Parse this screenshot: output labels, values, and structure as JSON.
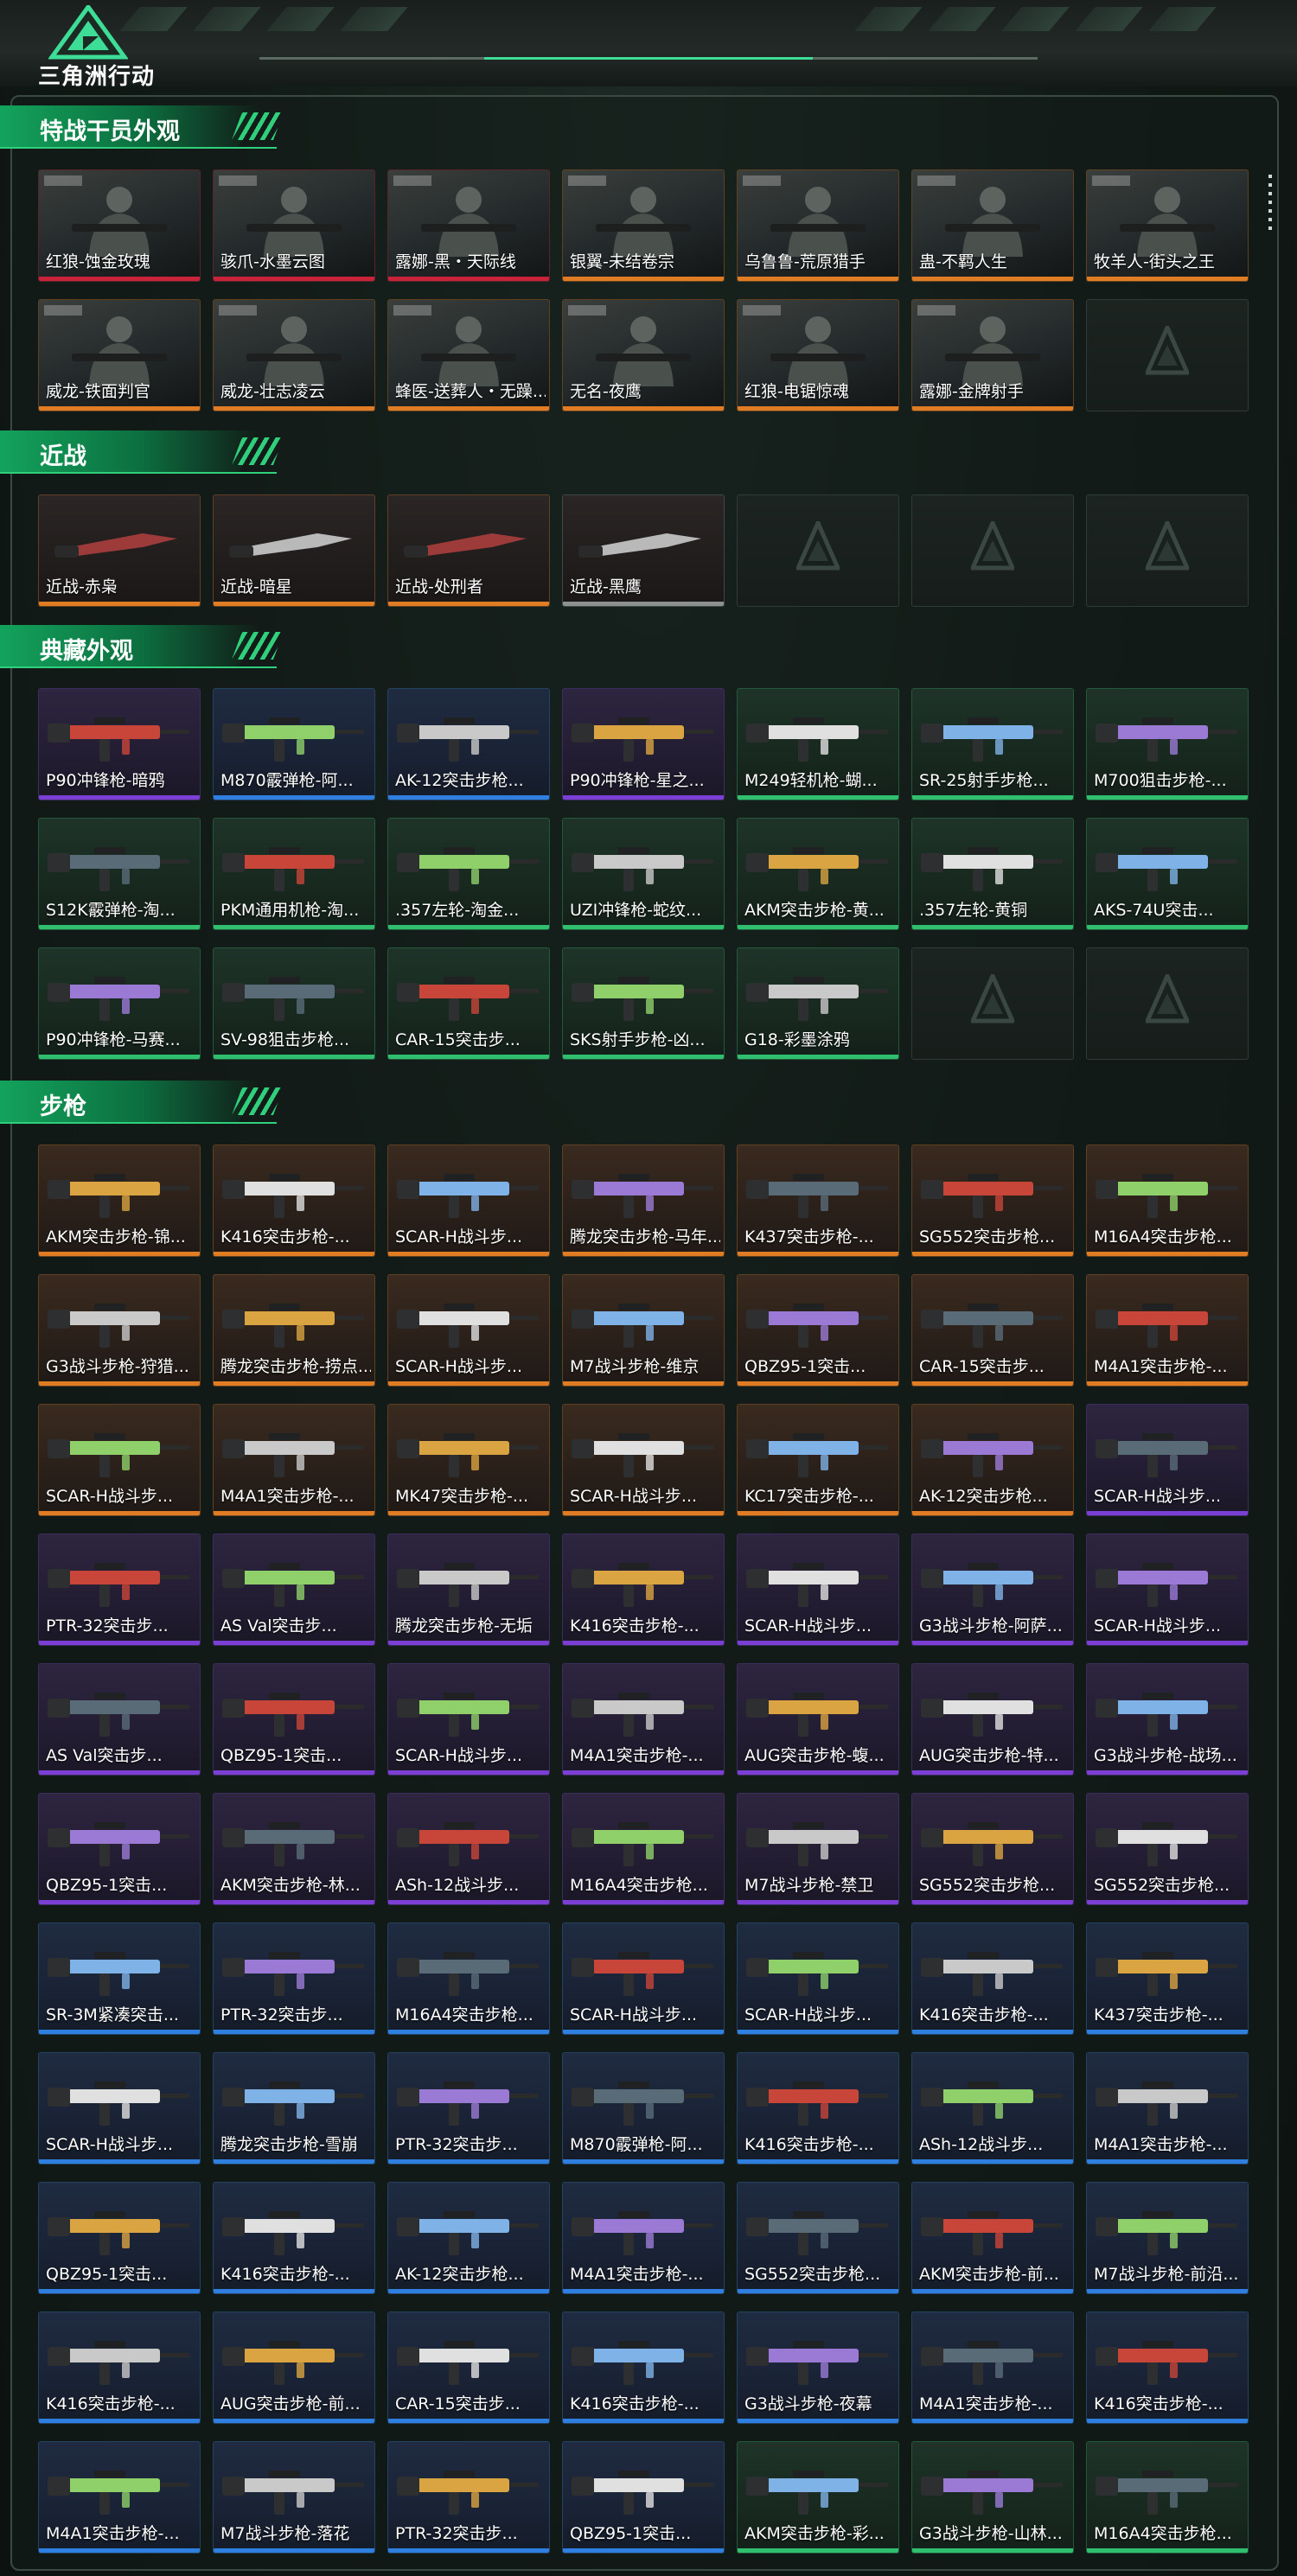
{
  "header": {
    "brand": "三角洲行动"
  },
  "colors": {
    "accent": "#2fcf7c",
    "rarity_orange": "#e07c24",
    "rarity_red": "#c8233a",
    "rarity_purple": "#7b3fd6",
    "rarity_blue": "#2f7fe0",
    "rarity_green": "#2fbf6f"
  },
  "sections": [
    {
      "title": "特战干员外观",
      "items": [
        {
          "label": "红狼-蚀金玫瑰",
          "rarity": "red",
          "tone": "operator"
        },
        {
          "label": "骇爪-水墨云图",
          "rarity": "red",
          "tone": "operator"
        },
        {
          "label": "露娜-黑・天际线",
          "rarity": "red",
          "tone": "operator"
        },
        {
          "label": "银翼-未结卷宗",
          "rarity": "orange",
          "tone": "operator"
        },
        {
          "label": "乌鲁鲁-荒原猎手",
          "rarity": "orange",
          "tone": "operator"
        },
        {
          "label": "蛊-不羁人生",
          "rarity": "orange",
          "tone": "operator"
        },
        {
          "label": "牧羊人-街头之王",
          "rarity": "orange",
          "tone": "operator"
        },
        {
          "label": "威龙-铁面判官",
          "rarity": "orange",
          "tone": "operator"
        },
        {
          "label": "威龙-壮志凌云",
          "rarity": "orange",
          "tone": "operator"
        },
        {
          "label": "蜂医-送葬人・无躁...",
          "rarity": "orange",
          "tone": "operator"
        },
        {
          "label": "无名-夜鹰",
          "rarity": "orange",
          "tone": "operator"
        },
        {
          "label": "红狼-电锯惊魂",
          "rarity": "orange",
          "tone": "operator"
        },
        {
          "label": "露娜-金牌射手",
          "rarity": "orange",
          "tone": "operator"
        }
      ]
    },
    {
      "title": "近战",
      "items": [
        {
          "label": "近战-赤枭",
          "rarity": "orange",
          "tone": "melee"
        },
        {
          "label": "近战-暗星",
          "rarity": "orange",
          "tone": "melee"
        },
        {
          "label": "近战-处刑者",
          "rarity": "orange",
          "tone": "melee"
        },
        {
          "label": "近战-黑鹰",
          "rarity": "grey",
          "tone": "melee"
        }
      ]
    },
    {
      "title": "典藏外观",
      "items": [
        {
          "label": "P90冲锋枪-暗鸦",
          "rarity": "purple",
          "tone": "purple"
        },
        {
          "label": "M870霰弹枪-阿...",
          "rarity": "blue",
          "tone": "blue"
        },
        {
          "label": "AK-12突击步枪...",
          "rarity": "blue",
          "tone": "blue"
        },
        {
          "label": "P90冲锋枪-星之...",
          "rarity": "purple",
          "tone": "purple"
        },
        {
          "label": "M249轻机枪-蝴...",
          "rarity": "green",
          "tone": "green"
        },
        {
          "label": "SR-25射手步枪...",
          "rarity": "green",
          "tone": "green"
        },
        {
          "label": "M700狙击步枪-...",
          "rarity": "green",
          "tone": "green"
        },
        {
          "label": "S12K霰弹枪-淘...",
          "rarity": "green",
          "tone": "green"
        },
        {
          "label": "PKM通用机枪-淘...",
          "rarity": "green",
          "tone": "green"
        },
        {
          "label": ".357左轮-淘金...",
          "rarity": "green",
          "tone": "green"
        },
        {
          "label": "UZI冲锋枪-蛇纹...",
          "rarity": "green",
          "tone": "green"
        },
        {
          "label": "AKM突击步枪-黄...",
          "rarity": "green",
          "tone": "green"
        },
        {
          "label": ".357左轮-黄铜",
          "rarity": "green",
          "tone": "green"
        },
        {
          "label": "AKS-74U突击...",
          "rarity": "green",
          "tone": "green"
        },
        {
          "label": "P90冲锋枪-马赛...",
          "rarity": "green",
          "tone": "green"
        },
        {
          "label": "SV-98狙击步枪...",
          "rarity": "green",
          "tone": "green"
        },
        {
          "label": "CAR-15突击步...",
          "rarity": "green",
          "tone": "green"
        },
        {
          "label": "SKS射手步枪-凶...",
          "rarity": "green",
          "tone": "green"
        },
        {
          "label": "G18-彩墨涂鸦",
          "rarity": "green",
          "tone": "green"
        }
      ]
    },
    {
      "title": "步枪",
      "items": [
        {
          "label": "AKM突击步枪-锦...",
          "rarity": "orange",
          "tone": "orange"
        },
        {
          "label": "K416突击步枪-...",
          "rarity": "orange",
          "tone": "orange"
        },
        {
          "label": "SCAR-H战斗步...",
          "rarity": "orange",
          "tone": "orange"
        },
        {
          "label": "腾龙突击步枪-马年...",
          "rarity": "orange",
          "tone": "orange"
        },
        {
          "label": "K437突击步枪-...",
          "rarity": "orange",
          "tone": "orange"
        },
        {
          "label": "SG552突击步枪...",
          "rarity": "orange",
          "tone": "orange"
        },
        {
          "label": "M16A4突击步枪...",
          "rarity": "orange",
          "tone": "orange"
        },
        {
          "label": "G3战斗步枪-狩猎...",
          "rarity": "orange",
          "tone": "orange"
        },
        {
          "label": "腾龙突击步枪-捞点...",
          "rarity": "orange",
          "tone": "orange"
        },
        {
          "label": "SCAR-H战斗步...",
          "rarity": "orange",
          "tone": "orange"
        },
        {
          "label": "M7战斗步枪-维京",
          "rarity": "orange",
          "tone": "orange"
        },
        {
          "label": "QBZ95-1突击...",
          "rarity": "orange",
          "tone": "orange"
        },
        {
          "label": "CAR-15突击步...",
          "rarity": "orange",
          "tone": "orange"
        },
        {
          "label": "M4A1突击步枪-...",
          "rarity": "orange",
          "tone": "orange"
        },
        {
          "label": "SCAR-H战斗步...",
          "rarity": "orange",
          "tone": "orange"
        },
        {
          "label": "M4A1突击步枪-...",
          "rarity": "orange",
          "tone": "orange"
        },
        {
          "label": "MK47突击步枪-...",
          "rarity": "orange",
          "tone": "orange"
        },
        {
          "label": "SCAR-H战斗步...",
          "rarity": "orange",
          "tone": "orange"
        },
        {
          "label": "KC17突击步枪-...",
          "rarity": "orange",
          "tone": "orange"
        },
        {
          "label": "AK-12突击步枪...",
          "rarity": "orange",
          "tone": "orange"
        },
        {
          "label": "SCAR-H战斗步...",
          "rarity": "purple",
          "tone": "purple"
        },
        {
          "label": "PTR-32突击步...",
          "rarity": "purple",
          "tone": "purple"
        },
        {
          "label": "AS Val突击步...",
          "rarity": "purple",
          "tone": "purple"
        },
        {
          "label": "腾龙突击步枪-无垢",
          "rarity": "purple",
          "tone": "purple"
        },
        {
          "label": "K416突击步枪-...",
          "rarity": "purple",
          "tone": "purple"
        },
        {
          "label": "SCAR-H战斗步...",
          "rarity": "purple",
          "tone": "purple"
        },
        {
          "label": "G3战斗步枪-阿萨...",
          "rarity": "purple",
          "tone": "purple"
        },
        {
          "label": "SCAR-H战斗步...",
          "rarity": "purple",
          "tone": "purple"
        },
        {
          "label": "AS Val突击步...",
          "rarity": "purple",
          "tone": "purple"
        },
        {
          "label": "QBZ95-1突击...",
          "rarity": "purple",
          "tone": "purple"
        },
        {
          "label": "SCAR-H战斗步...",
          "rarity": "purple",
          "tone": "purple"
        },
        {
          "label": "M4A1突击步枪-...",
          "rarity": "purple",
          "tone": "purple"
        },
        {
          "label": "AUG突击步枪-蝮...",
          "rarity": "purple",
          "tone": "purple"
        },
        {
          "label": "AUG突击步枪-特...",
          "rarity": "purple",
          "tone": "purple"
        },
        {
          "label": "G3战斗步枪-战场...",
          "rarity": "purple",
          "tone": "purple"
        },
        {
          "label": "QBZ95-1突击...",
          "rarity": "purple",
          "tone": "purple"
        },
        {
          "label": "AKM突击步枪-林...",
          "rarity": "purple",
          "tone": "purple"
        },
        {
          "label": "ASh-12战斗步...",
          "rarity": "purple",
          "tone": "purple"
        },
        {
          "label": "M16A4突击步枪...",
          "rarity": "purple",
          "tone": "purple"
        },
        {
          "label": "M7战斗步枪-禁卫",
          "rarity": "purple",
          "tone": "purple"
        },
        {
          "label": "SG552突击步枪...",
          "rarity": "purple",
          "tone": "purple"
        },
        {
          "label": "SG552突击步枪...",
          "rarity": "purple",
          "tone": "purple"
        },
        {
          "label": "SR-3M紧凑突击...",
          "rarity": "blue",
          "tone": "blue"
        },
        {
          "label": "PTR-32突击步...",
          "rarity": "blue",
          "tone": "blue"
        },
        {
          "label": "M16A4突击步枪...",
          "rarity": "blue",
          "tone": "blue"
        },
        {
          "label": "SCAR-H战斗步...",
          "rarity": "blue",
          "tone": "blue"
        },
        {
          "label": "SCAR-H战斗步...",
          "rarity": "blue",
          "tone": "blue"
        },
        {
          "label": "K416突击步枪-...",
          "rarity": "blue",
          "tone": "blue"
        },
        {
          "label": "K437突击步枪-...",
          "rarity": "blue",
          "tone": "blue"
        },
        {
          "label": "SCAR-H战斗步...",
          "rarity": "blue",
          "tone": "blue"
        },
        {
          "label": "腾龙突击步枪-雪崩",
          "rarity": "blue",
          "tone": "blue"
        },
        {
          "label": "PTR-32突击步...",
          "rarity": "blue",
          "tone": "blue"
        },
        {
          "label": "M870霰弹枪-阿...",
          "rarity": "blue",
          "tone": "blue"
        },
        {
          "label": "K416突击步枪-...",
          "rarity": "blue",
          "tone": "blue"
        },
        {
          "label": "ASh-12战斗步...",
          "rarity": "blue",
          "tone": "blue"
        },
        {
          "label": "M4A1突击步枪-...",
          "rarity": "blue",
          "tone": "blue"
        },
        {
          "label": "QBZ95-1突击...",
          "rarity": "blue",
          "tone": "blue"
        },
        {
          "label": "K416突击步枪-...",
          "rarity": "blue",
          "tone": "blue"
        },
        {
          "label": "AK-12突击步枪...",
          "rarity": "blue",
          "tone": "blue"
        },
        {
          "label": "M4A1突击步枪-...",
          "rarity": "blue",
          "tone": "blue"
        },
        {
          "label": "SG552突击步枪...",
          "rarity": "blue",
          "tone": "blue"
        },
        {
          "label": "AKM突击步枪-前...",
          "rarity": "blue",
          "tone": "blue"
        },
        {
          "label": "M7战斗步枪-前沿...",
          "rarity": "blue",
          "tone": "blue"
        },
        {
          "label": "K416突击步枪-...",
          "rarity": "blue",
          "tone": "blue"
        },
        {
          "label": "AUG突击步枪-前...",
          "rarity": "blue",
          "tone": "blue"
        },
        {
          "label": "CAR-15突击步...",
          "rarity": "blue",
          "tone": "blue"
        },
        {
          "label": "K416突击步枪-...",
          "rarity": "blue",
          "tone": "blue"
        },
        {
          "label": "G3战斗步枪-夜幕",
          "rarity": "blue",
          "tone": "blue"
        },
        {
          "label": "M4A1突击步枪-...",
          "rarity": "blue",
          "tone": "blue"
        },
        {
          "label": "K416突击步枪-...",
          "rarity": "blue",
          "tone": "blue"
        },
        {
          "label": "M4A1突击步枪-...",
          "rarity": "blue",
          "tone": "blue"
        },
        {
          "label": "M7战斗步枪-落花",
          "rarity": "blue",
          "tone": "blue"
        },
        {
          "label": "PTR-32突击步...",
          "rarity": "blue",
          "tone": "blue"
        },
        {
          "label": "QBZ95-1突击...",
          "rarity": "blue",
          "tone": "blue"
        },
        {
          "label": "AKM突击步枪-彩...",
          "rarity": "green",
          "tone": "green"
        },
        {
          "label": "G3战斗步枪-山林...",
          "rarity": "green",
          "tone": "green"
        },
        {
          "label": "M16A4突击步枪...",
          "rarity": "green",
          "tone": "green"
        }
      ]
    }
  ]
}
